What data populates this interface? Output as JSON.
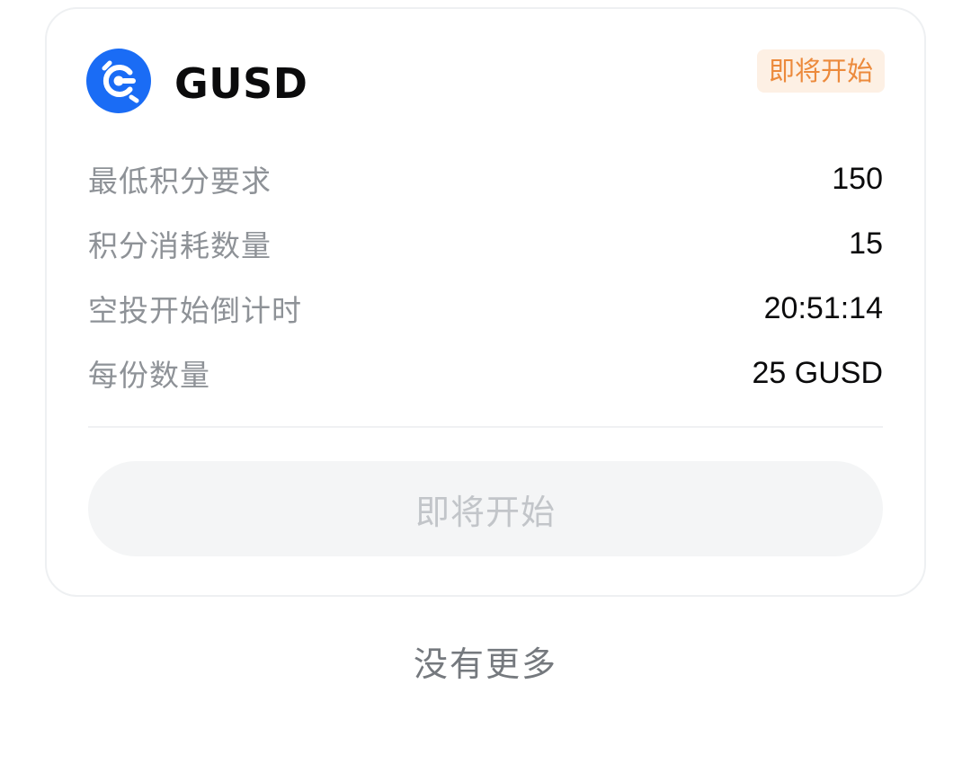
{
  "card": {
    "coin_icon": "gusd-coin-icon",
    "coin_name": "GUSD",
    "status_badge": "即将开始",
    "rows": [
      {
        "label": "最低积分要求",
        "value": "150"
      },
      {
        "label": "积分消耗数量",
        "value": "15"
      },
      {
        "label": "空投开始倒计时",
        "value": "20:51:14"
      },
      {
        "label": "每份数量",
        "value": "25 GUSD"
      }
    ],
    "action_button": "即将开始"
  },
  "footer": {
    "no_more_text": "没有更多"
  },
  "colors": {
    "brand_blue": "#1a6cf5",
    "badge_text": "#ec8a3c",
    "badge_bg": "#fdf0e4",
    "label_gray": "#8e9297",
    "disabled_button_bg": "#f4f5f6",
    "disabled_button_text": "#c2c5c9"
  }
}
